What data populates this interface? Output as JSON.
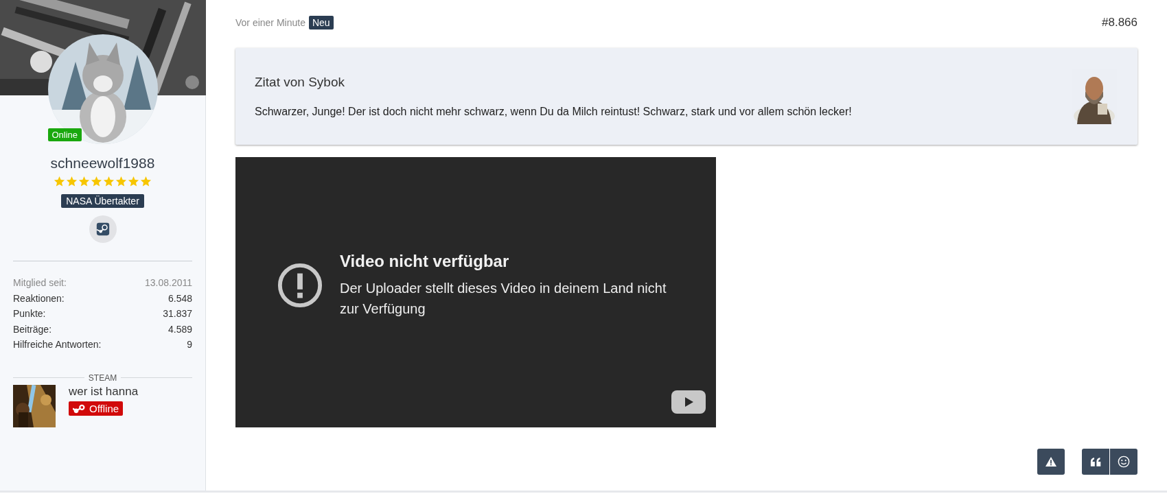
{
  "user": {
    "status_badge": "Online",
    "username": "schneewolf1988",
    "stars": 8,
    "rank_badge": "NASA Übertakter",
    "stats": [
      {
        "label": "Mitglied seit:",
        "value": "13.08.2011",
        "muted": true
      },
      {
        "label": "Reaktionen:",
        "value": "6.548",
        "muted": false
      },
      {
        "label": "Punkte:",
        "value": "31.837",
        "muted": false
      },
      {
        "label": "Beiträge:",
        "value": "4.589",
        "muted": false
      },
      {
        "label": "Hilfreiche Antworten:",
        "value": "9",
        "muted": false
      }
    ],
    "steam": {
      "heading": "STEAM",
      "name": "wer ist hanna",
      "status": "Offline"
    }
  },
  "post": {
    "time": "Vor einer Minute",
    "new_badge": "Neu",
    "number": "#8.866",
    "quote": {
      "title": "Zitat von Sybok",
      "text": "Schwarzer, Junge! Der ist doch nicht mehr schwarz, wenn Du da Milch reintust! Schwarz, stark und vor allem schön lecker!"
    },
    "video": {
      "title": "Video nicht verfügbar",
      "message": "Der Uploader stellt dieses Video in deinem Land nicht zur Verfügung"
    },
    "actions": [
      {
        "kind": "report"
      },
      {
        "kind": "quote"
      },
      {
        "kind": "react"
      }
    ]
  }
}
